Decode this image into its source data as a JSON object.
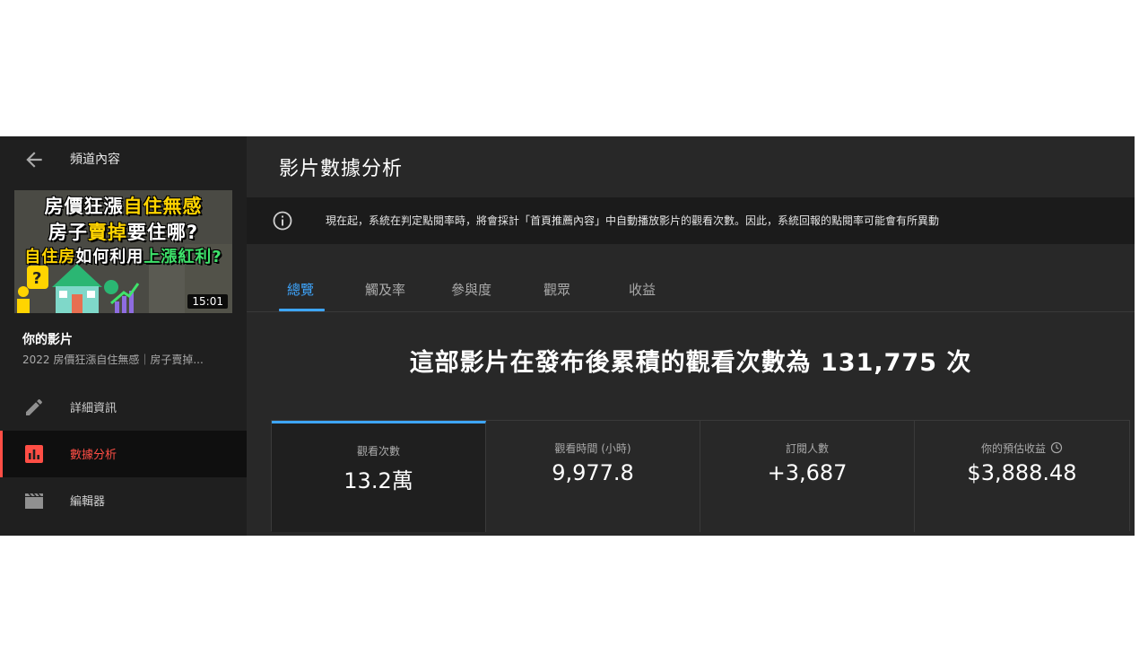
{
  "sidebar": {
    "title": "頻道內容",
    "thumbnail": {
      "line1_a": "房價狂漲",
      "line1_b": "自住無感",
      "line2_a": "房子",
      "line2_b": "賣掉",
      "line2_c": "要住哪?",
      "line3_a": "自住房",
      "line3_b": "如何利用",
      "line3_c": "上漲紅利?",
      "duration": "15:01"
    },
    "your_video_label": "你的影片",
    "video_title": "2022 房價狂漲自住無感｜房子賣掉...",
    "nav": [
      {
        "label": "詳細資訊",
        "icon": "pencil-icon",
        "active": false
      },
      {
        "label": "數據分析",
        "icon": "analytics-icon",
        "active": true
      },
      {
        "label": "編輯器",
        "icon": "clapperboard-icon",
        "active": false
      }
    ]
  },
  "main": {
    "title": "影片數據分析",
    "banner": {
      "icon": "info-icon",
      "text": "現在起，系統在判定點閱率時，將會採計「首頁推薦內容」中自動播放影片的觀看次數。因此，系統回報的點閱率可能會有所異動"
    },
    "tabs": [
      {
        "label": "總覽",
        "active": true
      },
      {
        "label": "觸及率",
        "active": false
      },
      {
        "label": "參與度",
        "active": false
      },
      {
        "label": "觀眾",
        "active": false
      },
      {
        "label": "收益",
        "active": false
      }
    ],
    "headline": "這部影片在發布後累積的觀看次數為 131,775 次",
    "metrics": [
      {
        "label": "觀看次數",
        "value": "13.2萬",
        "active": true
      },
      {
        "label": "觀看時間 (小時)",
        "value": "9,977.8",
        "active": false
      },
      {
        "label": "訂閱人數",
        "value": "+3,687",
        "active": false
      },
      {
        "label": "你的預估收益",
        "value": "$3,888.48",
        "active": false,
        "icon": "clock-icon"
      }
    ]
  },
  "colors": {
    "accent_blue": "#3ea6ff",
    "accent_red": "#ff4e45",
    "background": "#282828",
    "sidebar_bg": "#1f1f1f"
  }
}
